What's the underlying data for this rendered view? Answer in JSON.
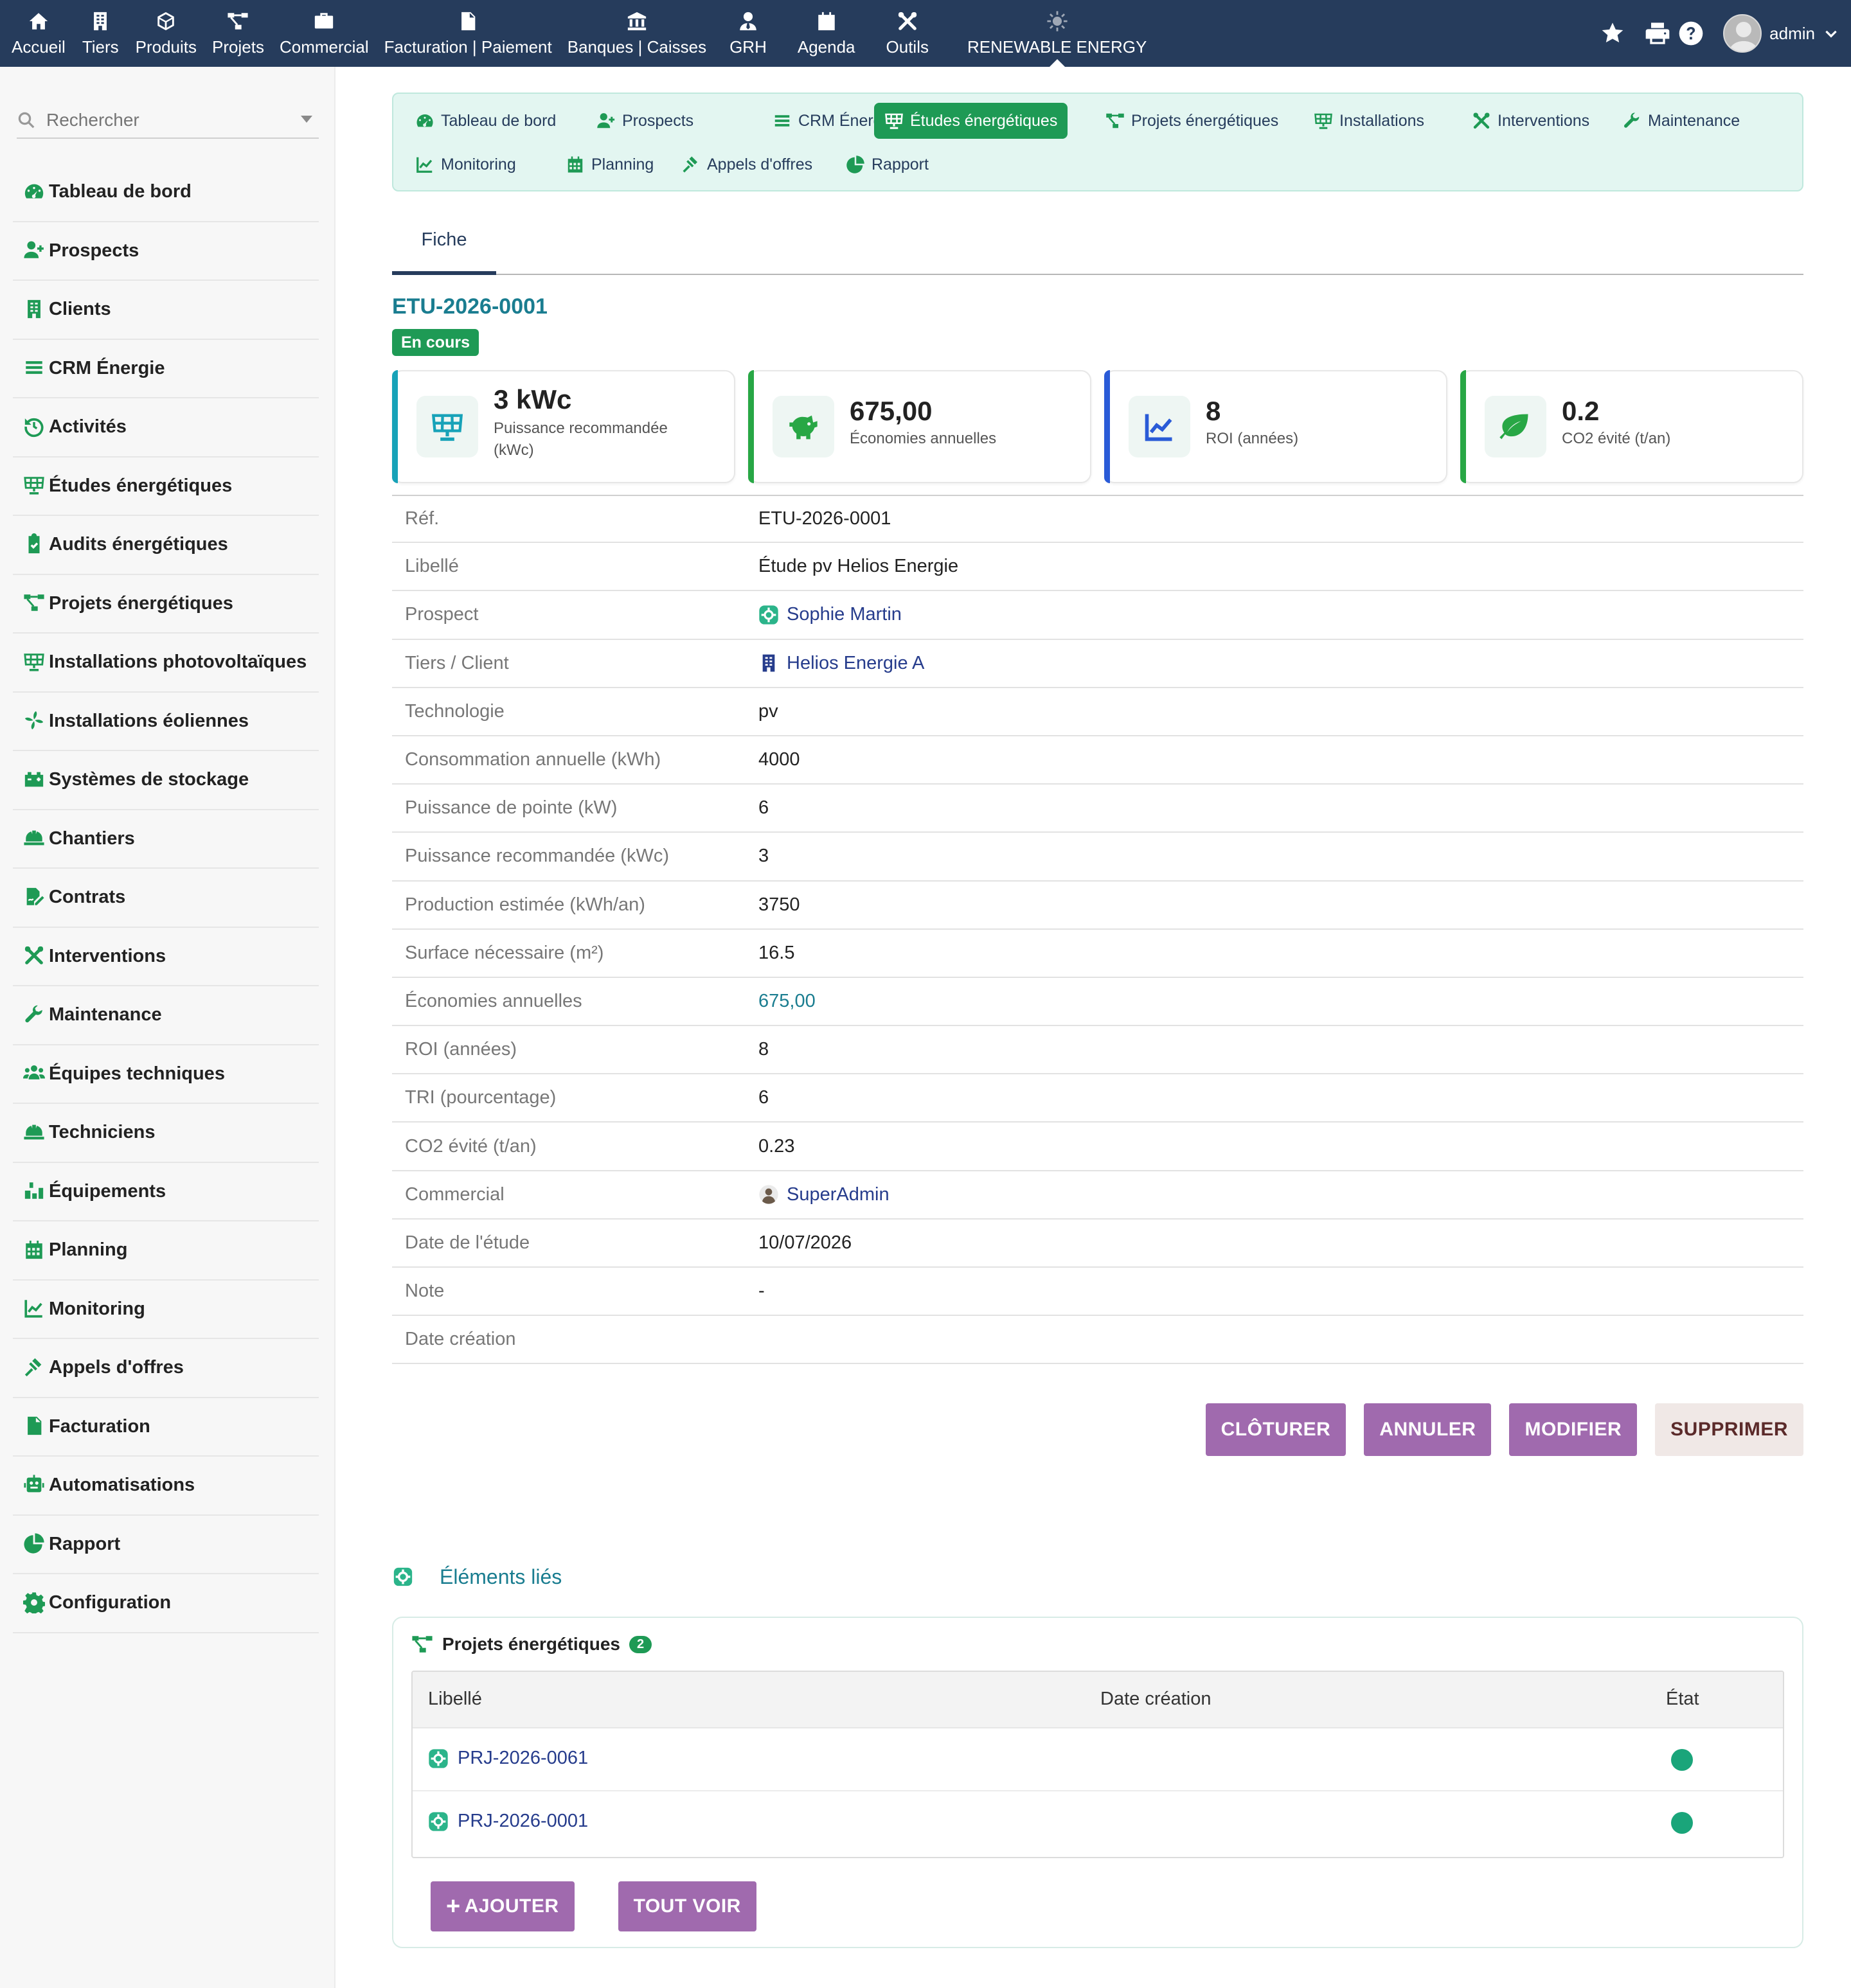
{
  "topnav": [
    {
      "label": "Accueil",
      "icon": "home-icon"
    },
    {
      "label": "Tiers",
      "icon": "building-icon"
    },
    {
      "label": "Produits",
      "icon": "cube-icon"
    },
    {
      "label": "Projets",
      "icon": "project-diagram-icon"
    },
    {
      "label": "Commercial",
      "icon": "briefcase-icon"
    },
    {
      "label": "Facturation | Paiement",
      "icon": "invoice-icon"
    },
    {
      "label": "Banques | Caisses",
      "icon": "bank-icon"
    },
    {
      "label": "GRH",
      "icon": "user-tie-icon"
    },
    {
      "label": "Agenda",
      "icon": "calendar-icon"
    },
    {
      "label": "Outils",
      "icon": "tools-icon"
    },
    {
      "label": "RENEWABLE ENERGY",
      "icon": "sun-icon"
    }
  ],
  "user": {
    "name": "admin"
  },
  "search": {
    "placeholder": "Rechercher"
  },
  "sidebar": [
    {
      "label": "Tableau de bord",
      "icon": "gauge-icon"
    },
    {
      "label": "Prospects",
      "icon": "user-plus-icon"
    },
    {
      "label": "Clients",
      "icon": "building-icon"
    },
    {
      "label": "CRM Énergie",
      "icon": "list-icon"
    },
    {
      "label": "Activités",
      "icon": "history-icon"
    },
    {
      "label": "Études énergétiques",
      "icon": "solar-panel-icon"
    },
    {
      "label": "Audits énergétiques",
      "icon": "clipboard-check-icon"
    },
    {
      "label": "Projets énergétiques",
      "icon": "project-diagram-icon"
    },
    {
      "label": "Installations photovoltaïques",
      "icon": "solar-panel-icon"
    },
    {
      "label": "Installations éoliennes",
      "icon": "fan-icon"
    },
    {
      "label": "Systèmes de stockage",
      "icon": "battery-icon"
    },
    {
      "label": "Chantiers",
      "icon": "hard-hat-icon"
    },
    {
      "label": "Contrats",
      "icon": "file-signature-icon"
    },
    {
      "label": "Interventions",
      "icon": "tools-icon"
    },
    {
      "label": "Maintenance",
      "icon": "wrench-icon"
    },
    {
      "label": "Équipes techniques",
      "icon": "users-icon"
    },
    {
      "label": "Techniciens",
      "icon": "hard-hat-icon"
    },
    {
      "label": "Équipements",
      "icon": "boxes-icon"
    },
    {
      "label": "Planning",
      "icon": "calendar-icon"
    },
    {
      "label": "Monitoring",
      "icon": "chart-line-icon"
    },
    {
      "label": "Appels d'offres",
      "icon": "gavel-icon"
    },
    {
      "label": "Facturation",
      "icon": "invoice-icon"
    },
    {
      "label": "Automatisations",
      "icon": "robot-icon"
    },
    {
      "label": "Rapport",
      "icon": "chart-pie-icon"
    },
    {
      "label": "Configuration",
      "icon": "gear-icon"
    }
  ],
  "subnav": [
    {
      "label": "Tableau de bord",
      "icon": "gauge-icon"
    },
    {
      "label": "Prospects",
      "icon": "user-plus-icon"
    },
    {
      "label": "CRM Énergie",
      "icon": "list-icon"
    },
    {
      "label": "Études énergétiques",
      "icon": "solar-panel-icon",
      "active": true
    },
    {
      "label": "Projets énergétiques",
      "icon": "project-diagram-icon"
    },
    {
      "label": "Installations",
      "icon": "solar-panel-icon"
    },
    {
      "label": "Interventions",
      "icon": "tools-icon"
    },
    {
      "label": "Maintenance",
      "icon": "wrench-icon"
    },
    {
      "label": "Monitoring",
      "icon": "chart-line-icon"
    },
    {
      "label": "Planning",
      "icon": "calendar-icon"
    },
    {
      "label": "Appels d'offres",
      "icon": "gavel-icon"
    },
    {
      "label": "Rapport",
      "icon": "chart-pie-icon"
    }
  ],
  "tab": {
    "label": "Fiche"
  },
  "record": {
    "ref": "ETU-2026-0001",
    "status": "En cours"
  },
  "cards": [
    {
      "value": "3 kWc",
      "label": "Puissance recommandée (kWc)",
      "icon": "solar-panel-icon",
      "color": "#17a2b8"
    },
    {
      "value": "675,00",
      "label": "Économies annuelles",
      "icon": "piggy-bank-icon",
      "color": "#28a745"
    },
    {
      "value": "8",
      "label": "ROI (années)",
      "icon": "chart-line-icon",
      "color": "#2a5bd7"
    },
    {
      "value": "0.2",
      "label": "CO2 évité (t/an)",
      "icon": "leaf-icon",
      "color": "#28a745"
    }
  ],
  "fields": [
    {
      "key": "Réf.",
      "value": "ETU-2026-0001"
    },
    {
      "key": "Libellé",
      "value": "Étude pv Helios Energie"
    },
    {
      "key": "Prospect",
      "value": "Sophie Martin",
      "style": "link",
      "icon": "prospect-icon"
    },
    {
      "key": "Tiers / Client",
      "value": "Helios Energie A",
      "style": "link",
      "icon": "building-icon"
    },
    {
      "key": "Technologie",
      "value": "pv"
    },
    {
      "key": "Consommation annuelle (kWh)",
      "value": "4000"
    },
    {
      "key": "Puissance de pointe (kW)",
      "value": "6"
    },
    {
      "key": "Puissance recommandée (kWc)",
      "value": "3"
    },
    {
      "key": "Production estimée (kWh/an)",
      "value": "3750"
    },
    {
      "key": "Surface nécessaire (m²)",
      "value": "16.5"
    },
    {
      "key": "Économies annuelles",
      "value": "675,00",
      "style": "teal"
    },
    {
      "key": "ROI (années)",
      "value": "8"
    },
    {
      "key": "TRI (pourcentage)",
      "value": "6"
    },
    {
      "key": "CO2 évité (t/an)",
      "value": "0.23"
    },
    {
      "key": "Commercial",
      "value": "SuperAdmin",
      "style": "link",
      "icon": "user-avatar-icon"
    },
    {
      "key": "Date de l'étude",
      "value": "10/07/2026"
    },
    {
      "key": "Note",
      "value": "-"
    },
    {
      "key": "Date création",
      "value": ""
    }
  ],
  "actions": [
    "CLÔTURER",
    "ANNULER",
    "MODIFIER",
    "SUPPRIMER"
  ],
  "linked": {
    "title": "Éléments liés",
    "panel_title": "Projets énergétiques",
    "count": "2",
    "columns": [
      "Libellé",
      "Date création",
      "État"
    ],
    "rows": [
      {
        "label": "PRJ-2026-0061",
        "date": ""
      },
      {
        "label": "PRJ-2026-0001",
        "date": ""
      }
    ],
    "add_label": "AJOUTER",
    "all_label": "TOUT VOIR"
  },
  "colors": {
    "topbar": "#263c5c",
    "accent_green": "#1e9a55",
    "teal": "#1a7d90",
    "button": "#a06aae"
  }
}
